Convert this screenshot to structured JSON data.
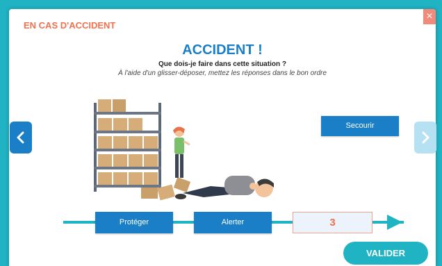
{
  "header": {
    "title": "EN CAS D'ACCIDENT",
    "close_label": "×"
  },
  "main": {
    "title": "ACCIDENT !",
    "question": "Que dois-je faire dans cette situation  ?",
    "instruction": "À l'aide d'un glisser-déposer, mettez les réponses dans le bon ordre"
  },
  "answers": {
    "secourir": "Secourir"
  },
  "timeline": {
    "slot1": "Protéger",
    "slot2": "Alerter",
    "slot3_number": "3"
  },
  "actions": {
    "validate_label": "VALIDER"
  },
  "colors": {
    "accent_blue": "#1a7fc6",
    "teal": "#1fb3c4",
    "header_orange": "#f0714f"
  },
  "icons": {
    "nav_prev": "chevron-left-icon",
    "nav_next": "chevron-right-icon",
    "close": "close-icon"
  }
}
